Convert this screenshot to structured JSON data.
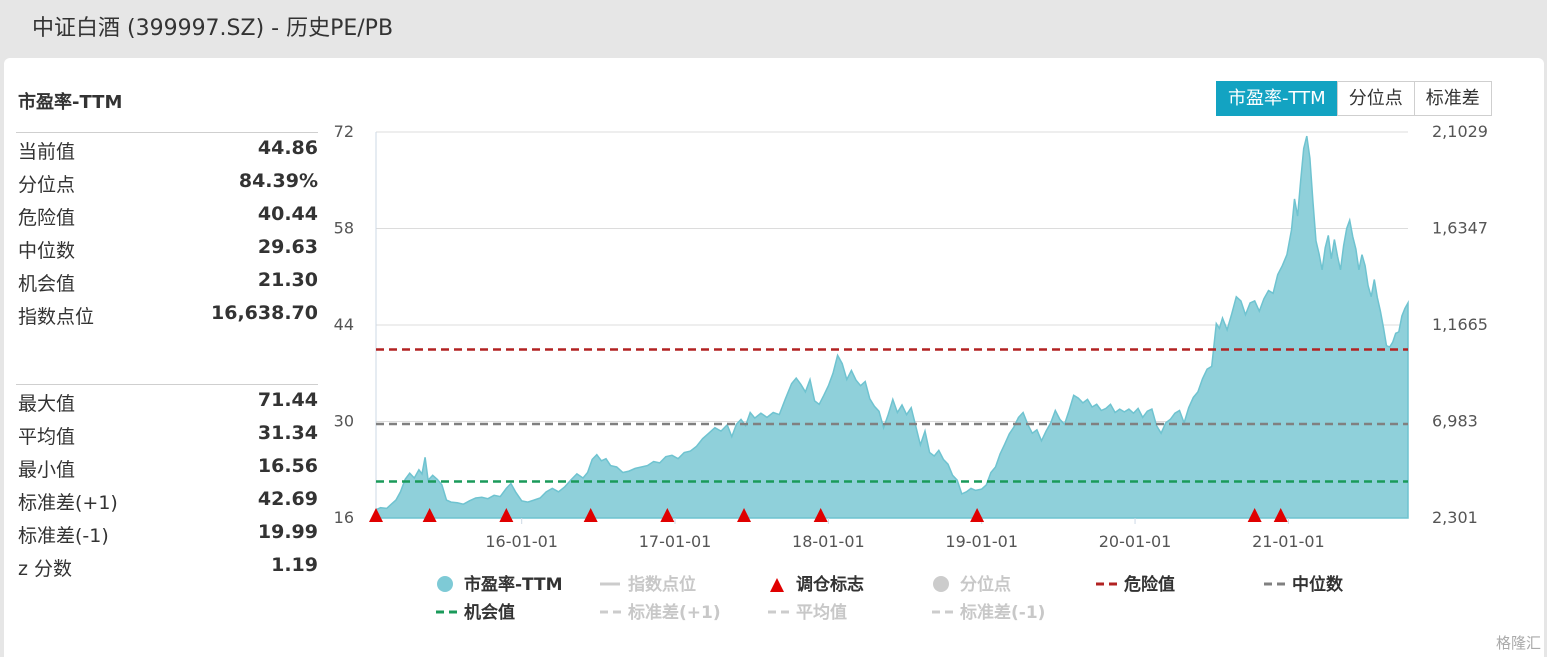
{
  "window": {
    "title": "中证白酒 (399997.SZ) - 历史PE/PB"
  },
  "left_panel": {
    "title": "市盈率-TTM",
    "stats1": [
      {
        "label": "当前值",
        "value": "44.86"
      },
      {
        "label": "分位点",
        "value": "84.39%"
      },
      {
        "label": "危险值",
        "value": "40.44"
      },
      {
        "label": "中位数",
        "value": "29.63"
      },
      {
        "label": "机会值",
        "value": "21.30"
      },
      {
        "label": "指数点位",
        "value": "16,638.70"
      }
    ],
    "stats2": [
      {
        "label": "最大值",
        "value": "71.44"
      },
      {
        "label": "平均值",
        "value": "31.34"
      },
      {
        "label": "最小值",
        "value": "16.56"
      },
      {
        "label": "标准差(+1)",
        "value": "42.69"
      },
      {
        "label": "标准差(-1)",
        "value": "19.99"
      },
      {
        "label": "z 分数",
        "value": "1.19"
      }
    ]
  },
  "tabs": [
    {
      "label": "市盈率-TTM",
      "active": true
    },
    {
      "label": "分位点",
      "active": false
    },
    {
      "label": "标准差",
      "active": false
    }
  ],
  "watermark": "格隆汇",
  "chart_data": {
    "type": "area",
    "title": "",
    "y_left": {
      "min": 16,
      "max": 72,
      "ticks": [
        "16",
        "30",
        "44",
        "58",
        "72"
      ]
    },
    "y_right": {
      "ticks": [
        "2,301",
        "6,983",
        "1,1665",
        "1,6347",
        "2,1029"
      ]
    },
    "x_ticks": [
      {
        "label": "16-01-01",
        "t": 2016.0
      },
      {
        "label": "17-01-01",
        "t": 2017.0
      },
      {
        "label": "18-01-01",
        "t": 2018.0
      },
      {
        "label": "19-01-01",
        "t": 2019.0
      },
      {
        "label": "20-01-01",
        "t": 2020.0
      },
      {
        "label": "21-01-01",
        "t": 2021.0
      }
    ],
    "x_range": [
      2015.05,
      2021.78
    ],
    "series": [
      {
        "name": "市盈率-TTM",
        "color": "#8fd0da",
        "points": [
          [
            2015.05,
            17.2
          ],
          [
            2015.08,
            17.5
          ],
          [
            2015.12,
            17.4
          ],
          [
            2015.15,
            18.0
          ],
          [
            2015.18,
            18.6
          ],
          [
            2015.21,
            19.8
          ],
          [
            2015.24,
            21.6
          ],
          [
            2015.27,
            22.5
          ],
          [
            2015.3,
            21.8
          ],
          [
            2015.33,
            23.0
          ],
          [
            2015.35,
            22.4
          ],
          [
            2015.37,
            24.8
          ],
          [
            2015.39,
            21.5
          ],
          [
            2015.42,
            22.2
          ],
          [
            2015.45,
            21.6
          ],
          [
            2015.48,
            20.8
          ],
          [
            2015.51,
            18.6
          ],
          [
            2015.54,
            18.3
          ],
          [
            2015.58,
            18.2
          ],
          [
            2015.62,
            18.0
          ],
          [
            2015.66,
            18.5
          ],
          [
            2015.7,
            18.9
          ],
          [
            2015.74,
            19.0
          ],
          [
            2015.78,
            18.8
          ],
          [
            2015.82,
            19.3
          ],
          [
            2015.86,
            19.1
          ],
          [
            2015.9,
            20.3
          ],
          [
            2015.93,
            21.0
          ],
          [
            2015.96,
            19.8
          ],
          [
            2016.0,
            18.5
          ],
          [
            2016.04,
            18.3
          ],
          [
            2016.08,
            18.6
          ],
          [
            2016.12,
            18.9
          ],
          [
            2016.16,
            19.8
          ],
          [
            2016.2,
            20.3
          ],
          [
            2016.24,
            19.8
          ],
          [
            2016.28,
            20.5
          ],
          [
            2016.32,
            21.5
          ],
          [
            2016.36,
            22.4
          ],
          [
            2016.4,
            21.8
          ],
          [
            2016.43,
            22.6
          ],
          [
            2016.46,
            24.5
          ],
          [
            2016.49,
            25.2
          ],
          [
            2016.52,
            24.3
          ],
          [
            2016.55,
            24.6
          ],
          [
            2016.58,
            23.6
          ],
          [
            2016.62,
            23.4
          ],
          [
            2016.66,
            22.6
          ],
          [
            2016.7,
            22.8
          ],
          [
            2016.74,
            23.2
          ],
          [
            2016.78,
            23.4
          ],
          [
            2016.82,
            23.6
          ],
          [
            2016.86,
            24.2
          ],
          [
            2016.9,
            24.0
          ],
          [
            2016.94,
            24.9
          ],
          [
            2016.98,
            25.1
          ],
          [
            2017.02,
            24.6
          ],
          [
            2017.06,
            25.5
          ],
          [
            2017.1,
            25.7
          ],
          [
            2017.14,
            26.4
          ],
          [
            2017.18,
            27.5
          ],
          [
            2017.22,
            28.3
          ],
          [
            2017.26,
            29.1
          ],
          [
            2017.3,
            28.6
          ],
          [
            2017.34,
            29.5
          ],
          [
            2017.37,
            27.8
          ],
          [
            2017.4,
            29.6
          ],
          [
            2017.43,
            30.3
          ],
          [
            2017.46,
            29.4
          ],
          [
            2017.49,
            31.3
          ],
          [
            2017.52,
            30.5
          ],
          [
            2017.56,
            31.2
          ],
          [
            2017.6,
            30.6
          ],
          [
            2017.64,
            31.3
          ],
          [
            2017.68,
            31.0
          ],
          [
            2017.72,
            33.3
          ],
          [
            2017.76,
            35.5
          ],
          [
            2017.79,
            36.3
          ],
          [
            2017.82,
            35.4
          ],
          [
            2017.85,
            34.3
          ],
          [
            2017.88,
            36.1
          ],
          [
            2017.91,
            33.0
          ],
          [
            2017.94,
            32.5
          ],
          [
            2017.97,
            33.8
          ],
          [
            2018.0,
            35.2
          ],
          [
            2018.03,
            37.0
          ],
          [
            2018.06,
            39.6
          ],
          [
            2018.09,
            38.4
          ],
          [
            2018.12,
            36.1
          ],
          [
            2018.15,
            37.4
          ],
          [
            2018.18,
            36.0
          ],
          [
            2018.21,
            35.2
          ],
          [
            2018.24,
            35.8
          ],
          [
            2018.27,
            33.3
          ],
          [
            2018.3,
            32.2
          ],
          [
            2018.33,
            31.5
          ],
          [
            2018.36,
            29.1
          ],
          [
            2018.39,
            31.0
          ],
          [
            2018.42,
            33.2
          ],
          [
            2018.45,
            31.3
          ],
          [
            2018.48,
            32.4
          ],
          [
            2018.51,
            31.0
          ],
          [
            2018.54,
            32.0
          ],
          [
            2018.57,
            29.3
          ],
          [
            2018.6,
            26.6
          ],
          [
            2018.63,
            28.6
          ],
          [
            2018.66,
            25.5
          ],
          [
            2018.69,
            25.0
          ],
          [
            2018.72,
            25.8
          ],
          [
            2018.75,
            24.5
          ],
          [
            2018.78,
            23.8
          ],
          [
            2018.81,
            22.2
          ],
          [
            2018.84,
            21.5
          ],
          [
            2018.87,
            19.5
          ],
          [
            2018.9,
            19.8
          ],
          [
            2018.93,
            20.3
          ],
          [
            2018.96,
            20.0
          ],
          [
            2019.0,
            20.2
          ],
          [
            2019.03,
            20.8
          ],
          [
            2019.06,
            22.6
          ],
          [
            2019.09,
            23.4
          ],
          [
            2019.12,
            25.3
          ],
          [
            2019.15,
            26.7
          ],
          [
            2019.18,
            28.2
          ],
          [
            2019.21,
            29.2
          ],
          [
            2019.24,
            30.6
          ],
          [
            2019.27,
            31.3
          ],
          [
            2019.3,
            29.6
          ],
          [
            2019.33,
            28.3
          ],
          [
            2019.36,
            28.8
          ],
          [
            2019.39,
            27.2
          ],
          [
            2019.42,
            28.6
          ],
          [
            2019.45,
            29.8
          ],
          [
            2019.48,
            31.6
          ],
          [
            2019.51,
            30.3
          ],
          [
            2019.54,
            29.6
          ],
          [
            2019.57,
            31.6
          ],
          [
            2019.6,
            33.8
          ],
          [
            2019.63,
            33.4
          ],
          [
            2019.66,
            32.7
          ],
          [
            2019.69,
            33.2
          ],
          [
            2019.72,
            32.1
          ],
          [
            2019.75,
            32.5
          ],
          [
            2019.78,
            31.6
          ],
          [
            2019.81,
            31.9
          ],
          [
            2019.84,
            32.5
          ],
          [
            2019.87,
            31.3
          ],
          [
            2019.9,
            31.8
          ],
          [
            2019.93,
            31.4
          ],
          [
            2019.96,
            31.8
          ],
          [
            2019.99,
            31.2
          ],
          [
            2020.02,
            31.9
          ],
          [
            2020.05,
            30.6
          ],
          [
            2020.08,
            31.5
          ],
          [
            2020.11,
            31.8
          ],
          [
            2020.14,
            29.4
          ],
          [
            2020.17,
            28.3
          ],
          [
            2020.2,
            29.8
          ],
          [
            2020.23,
            30.3
          ],
          [
            2020.26,
            31.2
          ],
          [
            2020.29,
            31.6
          ],
          [
            2020.32,
            29.8
          ],
          [
            2020.35,
            32.0
          ],
          [
            2020.38,
            33.5
          ],
          [
            2020.41,
            34.3
          ],
          [
            2020.44,
            36.2
          ],
          [
            2020.47,
            37.6
          ],
          [
            2020.5,
            38.0
          ],
          [
            2020.53,
            44.2
          ],
          [
            2020.55,
            43.5
          ],
          [
            2020.57,
            45.0
          ],
          [
            2020.6,
            43.3
          ],
          [
            2020.63,
            45.6
          ],
          [
            2020.66,
            48.1
          ],
          [
            2020.69,
            47.5
          ],
          [
            2020.72,
            45.5
          ],
          [
            2020.75,
            47.2
          ],
          [
            2020.78,
            47.5
          ],
          [
            2020.81,
            46.0
          ],
          [
            2020.84,
            47.8
          ],
          [
            2020.87,
            49.0
          ],
          [
            2020.9,
            48.6
          ],
          [
            2020.93,
            51.3
          ],
          [
            2020.96,
            52.6
          ],
          [
            2020.99,
            54.2
          ],
          [
            2021.02,
            57.8
          ],
          [
            2021.04,
            62.3
          ],
          [
            2021.06,
            59.8
          ],
          [
            2021.08,
            65.0
          ],
          [
            2021.1,
            69.6
          ],
          [
            2021.12,
            71.4
          ],
          [
            2021.14,
            68.2
          ],
          [
            2021.16,
            62.0
          ],
          [
            2021.18,
            56.2
          ],
          [
            2021.2,
            54.3
          ],
          [
            2021.22,
            52.0
          ],
          [
            2021.24,
            55.2
          ],
          [
            2021.26,
            57.0
          ],
          [
            2021.28,
            53.6
          ],
          [
            2021.3,
            56.4
          ],
          [
            2021.32,
            54.0
          ],
          [
            2021.34,
            52.0
          ],
          [
            2021.36,
            55.5
          ],
          [
            2021.38,
            58.0
          ],
          [
            2021.4,
            59.2
          ],
          [
            2021.42,
            56.8
          ],
          [
            2021.44,
            55.0
          ],
          [
            2021.46,
            52.0
          ],
          [
            2021.48,
            54.2
          ],
          [
            2021.5,
            52.6
          ],
          [
            2021.52,
            49.7
          ],
          [
            2021.54,
            48.1
          ],
          [
            2021.56,
            50.6
          ],
          [
            2021.58,
            48.0
          ],
          [
            2021.6,
            46.0
          ],
          [
            2021.62,
            43.6
          ],
          [
            2021.64,
            41.0
          ],
          [
            2021.66,
            40.8
          ],
          [
            2021.68,
            41.5
          ],
          [
            2021.7,
            42.8
          ],
          [
            2021.72,
            43.0
          ],
          [
            2021.74,
            45.3
          ],
          [
            2021.76,
            46.4
          ],
          [
            2021.78,
            47.2
          ]
        ]
      }
    ],
    "reference_lines": [
      {
        "name": "危险值",
        "value": 40.44,
        "color": "#b22222"
      },
      {
        "name": "中位数",
        "value": 29.63,
        "color": "#808080"
      },
      {
        "name": "机会值",
        "value": 21.3,
        "color": "#1a9a5a"
      }
    ],
    "markers": {
      "name": "调仓标志",
      "color": "#e00000",
      "t": [
        2015.0,
        2015.4,
        2015.9,
        2016.45,
        2016.95,
        2017.45,
        2017.95,
        2018.97,
        2020.78,
        2020.95
      ]
    },
    "legend": [
      {
        "label": "市盈率-TTM",
        "symbol": "circle",
        "color": "#7ecad6",
        "active": true
      },
      {
        "label": "指数点位",
        "symbol": "line",
        "color": "#cccccc",
        "active": false
      },
      {
        "label": "调仓标志",
        "symbol": "triangle",
        "color": "#e00000",
        "active": true
      },
      {
        "label": "分位点",
        "symbol": "circle",
        "color": "#cccccc",
        "active": false
      },
      {
        "label": "危险值",
        "symbol": "dash",
        "color": "#b22222",
        "active": true
      },
      {
        "label": "中位数",
        "symbol": "dash",
        "color": "#808080",
        "active": true
      },
      {
        "label": "机会值",
        "symbol": "dash",
        "color": "#1a9a5a",
        "active": true
      },
      {
        "label": "标准差(+1)",
        "symbol": "dash",
        "color": "#cccccc",
        "active": false
      },
      {
        "label": "平均值",
        "symbol": "dash",
        "color": "#cccccc",
        "active": false
      },
      {
        "label": "标准差(-1)",
        "symbol": "dash",
        "color": "#cccccc",
        "active": false
      }
    ]
  }
}
